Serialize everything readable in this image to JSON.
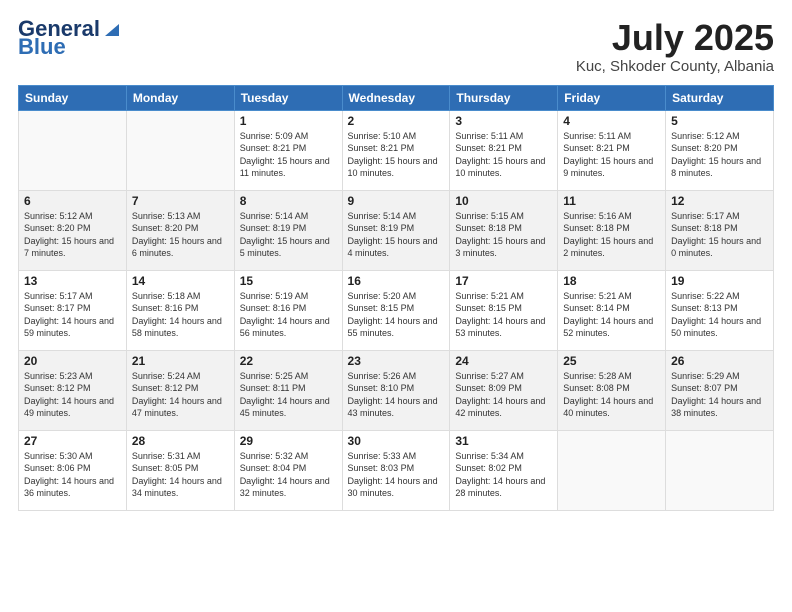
{
  "header": {
    "logo_general": "General",
    "logo_blue": "Blue",
    "month_year": "July 2025",
    "location": "Kuc, Shkoder County, Albania"
  },
  "days_of_week": [
    "Sunday",
    "Monday",
    "Tuesday",
    "Wednesday",
    "Thursday",
    "Friday",
    "Saturday"
  ],
  "weeks": [
    [
      {
        "day": "",
        "sunrise": "",
        "sunset": "",
        "daylight": ""
      },
      {
        "day": "",
        "sunrise": "",
        "sunset": "",
        "daylight": ""
      },
      {
        "day": "1",
        "sunrise": "Sunrise: 5:09 AM",
        "sunset": "Sunset: 8:21 PM",
        "daylight": "Daylight: 15 hours and 11 minutes."
      },
      {
        "day": "2",
        "sunrise": "Sunrise: 5:10 AM",
        "sunset": "Sunset: 8:21 PM",
        "daylight": "Daylight: 15 hours and 10 minutes."
      },
      {
        "day": "3",
        "sunrise": "Sunrise: 5:11 AM",
        "sunset": "Sunset: 8:21 PM",
        "daylight": "Daylight: 15 hours and 10 minutes."
      },
      {
        "day": "4",
        "sunrise": "Sunrise: 5:11 AM",
        "sunset": "Sunset: 8:21 PM",
        "daylight": "Daylight: 15 hours and 9 minutes."
      },
      {
        "day": "5",
        "sunrise": "Sunrise: 5:12 AM",
        "sunset": "Sunset: 8:20 PM",
        "daylight": "Daylight: 15 hours and 8 minutes."
      }
    ],
    [
      {
        "day": "6",
        "sunrise": "Sunrise: 5:12 AM",
        "sunset": "Sunset: 8:20 PM",
        "daylight": "Daylight: 15 hours and 7 minutes."
      },
      {
        "day": "7",
        "sunrise": "Sunrise: 5:13 AM",
        "sunset": "Sunset: 8:20 PM",
        "daylight": "Daylight: 15 hours and 6 minutes."
      },
      {
        "day": "8",
        "sunrise": "Sunrise: 5:14 AM",
        "sunset": "Sunset: 8:19 PM",
        "daylight": "Daylight: 15 hours and 5 minutes."
      },
      {
        "day": "9",
        "sunrise": "Sunrise: 5:14 AM",
        "sunset": "Sunset: 8:19 PM",
        "daylight": "Daylight: 15 hours and 4 minutes."
      },
      {
        "day": "10",
        "sunrise": "Sunrise: 5:15 AM",
        "sunset": "Sunset: 8:18 PM",
        "daylight": "Daylight: 15 hours and 3 minutes."
      },
      {
        "day": "11",
        "sunrise": "Sunrise: 5:16 AM",
        "sunset": "Sunset: 8:18 PM",
        "daylight": "Daylight: 15 hours and 2 minutes."
      },
      {
        "day": "12",
        "sunrise": "Sunrise: 5:17 AM",
        "sunset": "Sunset: 8:18 PM",
        "daylight": "Daylight: 15 hours and 0 minutes."
      }
    ],
    [
      {
        "day": "13",
        "sunrise": "Sunrise: 5:17 AM",
        "sunset": "Sunset: 8:17 PM",
        "daylight": "Daylight: 14 hours and 59 minutes."
      },
      {
        "day": "14",
        "sunrise": "Sunrise: 5:18 AM",
        "sunset": "Sunset: 8:16 PM",
        "daylight": "Daylight: 14 hours and 58 minutes."
      },
      {
        "day": "15",
        "sunrise": "Sunrise: 5:19 AM",
        "sunset": "Sunset: 8:16 PM",
        "daylight": "Daylight: 14 hours and 56 minutes."
      },
      {
        "day": "16",
        "sunrise": "Sunrise: 5:20 AM",
        "sunset": "Sunset: 8:15 PM",
        "daylight": "Daylight: 14 hours and 55 minutes."
      },
      {
        "day": "17",
        "sunrise": "Sunrise: 5:21 AM",
        "sunset": "Sunset: 8:15 PM",
        "daylight": "Daylight: 14 hours and 53 minutes."
      },
      {
        "day": "18",
        "sunrise": "Sunrise: 5:21 AM",
        "sunset": "Sunset: 8:14 PM",
        "daylight": "Daylight: 14 hours and 52 minutes."
      },
      {
        "day": "19",
        "sunrise": "Sunrise: 5:22 AM",
        "sunset": "Sunset: 8:13 PM",
        "daylight": "Daylight: 14 hours and 50 minutes."
      }
    ],
    [
      {
        "day": "20",
        "sunrise": "Sunrise: 5:23 AM",
        "sunset": "Sunset: 8:12 PM",
        "daylight": "Daylight: 14 hours and 49 minutes."
      },
      {
        "day": "21",
        "sunrise": "Sunrise: 5:24 AM",
        "sunset": "Sunset: 8:12 PM",
        "daylight": "Daylight: 14 hours and 47 minutes."
      },
      {
        "day": "22",
        "sunrise": "Sunrise: 5:25 AM",
        "sunset": "Sunset: 8:11 PM",
        "daylight": "Daylight: 14 hours and 45 minutes."
      },
      {
        "day": "23",
        "sunrise": "Sunrise: 5:26 AM",
        "sunset": "Sunset: 8:10 PM",
        "daylight": "Daylight: 14 hours and 43 minutes."
      },
      {
        "day": "24",
        "sunrise": "Sunrise: 5:27 AM",
        "sunset": "Sunset: 8:09 PM",
        "daylight": "Daylight: 14 hours and 42 minutes."
      },
      {
        "day": "25",
        "sunrise": "Sunrise: 5:28 AM",
        "sunset": "Sunset: 8:08 PM",
        "daylight": "Daylight: 14 hours and 40 minutes."
      },
      {
        "day": "26",
        "sunrise": "Sunrise: 5:29 AM",
        "sunset": "Sunset: 8:07 PM",
        "daylight": "Daylight: 14 hours and 38 minutes."
      }
    ],
    [
      {
        "day": "27",
        "sunrise": "Sunrise: 5:30 AM",
        "sunset": "Sunset: 8:06 PM",
        "daylight": "Daylight: 14 hours and 36 minutes."
      },
      {
        "day": "28",
        "sunrise": "Sunrise: 5:31 AM",
        "sunset": "Sunset: 8:05 PM",
        "daylight": "Daylight: 14 hours and 34 minutes."
      },
      {
        "day": "29",
        "sunrise": "Sunrise: 5:32 AM",
        "sunset": "Sunset: 8:04 PM",
        "daylight": "Daylight: 14 hours and 32 minutes."
      },
      {
        "day": "30",
        "sunrise": "Sunrise: 5:33 AM",
        "sunset": "Sunset: 8:03 PM",
        "daylight": "Daylight: 14 hours and 30 minutes."
      },
      {
        "day": "31",
        "sunrise": "Sunrise: 5:34 AM",
        "sunset": "Sunset: 8:02 PM",
        "daylight": "Daylight: 14 hours and 28 minutes."
      },
      {
        "day": "",
        "sunrise": "",
        "sunset": "",
        "daylight": ""
      },
      {
        "day": "",
        "sunrise": "",
        "sunset": "",
        "daylight": ""
      }
    ]
  ]
}
